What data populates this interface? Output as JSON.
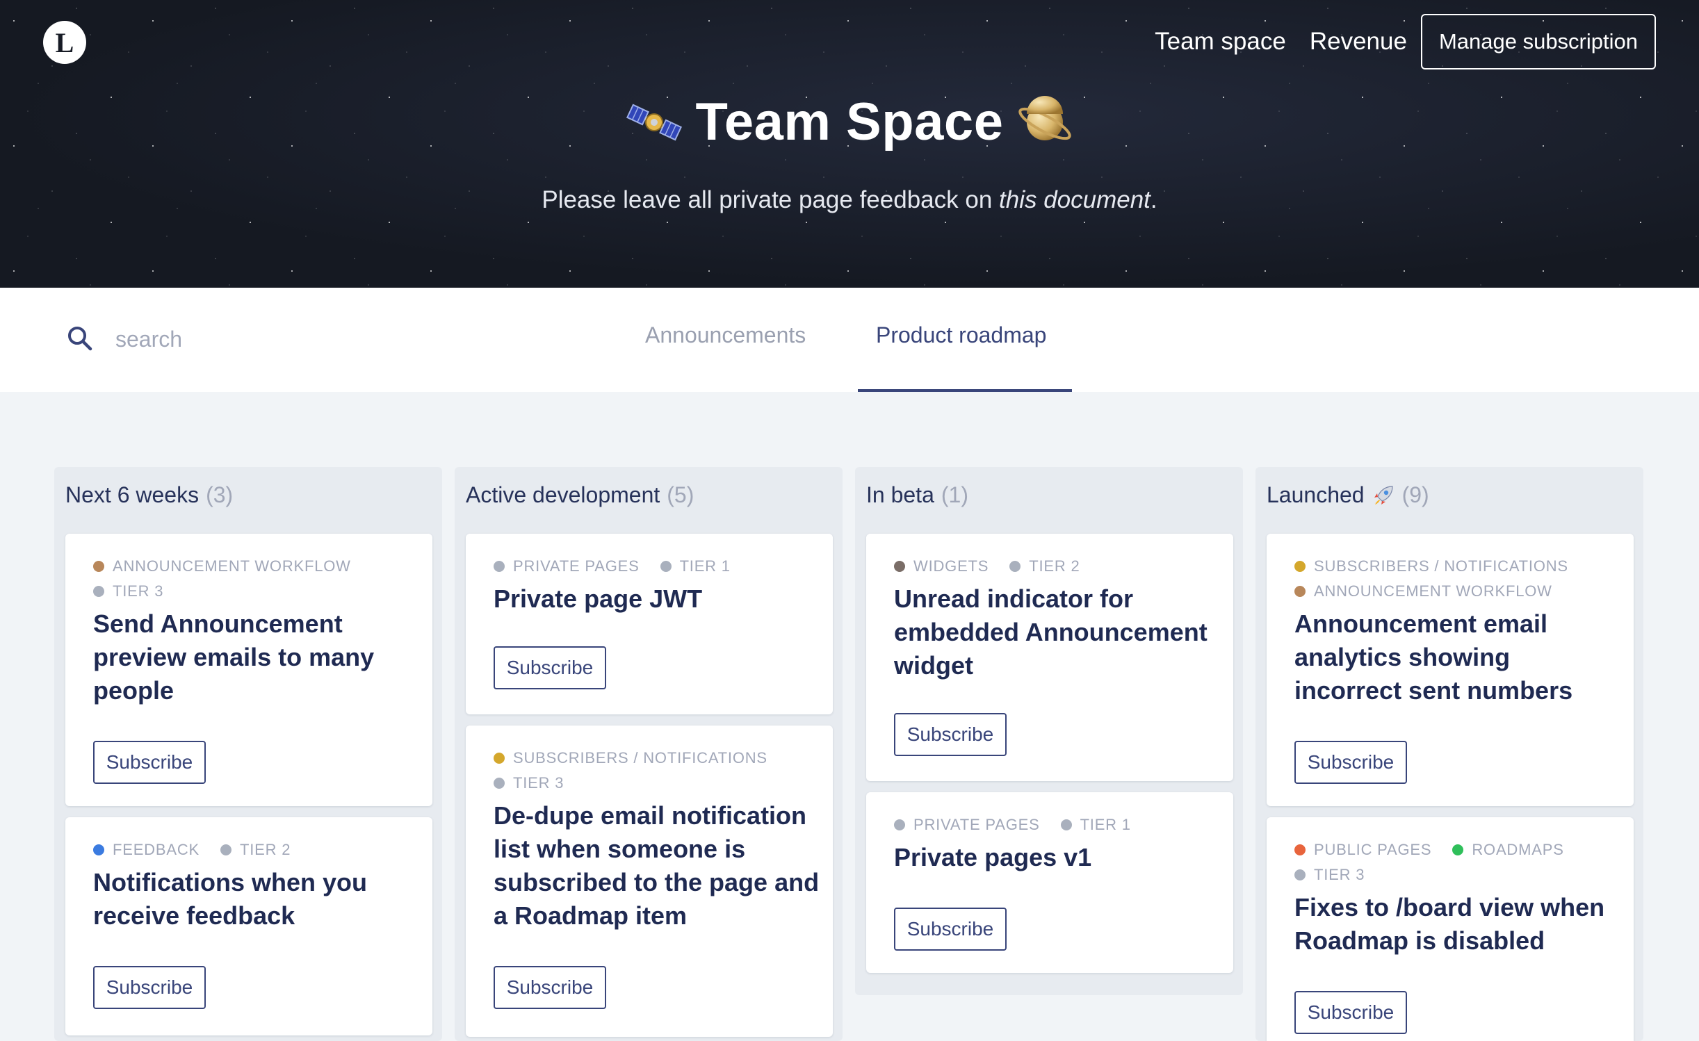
{
  "header": {
    "logo_letter": "L",
    "nav": [
      {
        "label": "Team space"
      },
      {
        "label": "Revenue"
      }
    ],
    "manage_label": "Manage subscription",
    "title": "Team Space",
    "subtitle_prefix": "Please leave all private page feedback on ",
    "subtitle_link": "this document",
    "subtitle_suffix": ".",
    "left_emoji_icon": "satellite-icon",
    "right_emoji_icon": "ringed-planet-icon"
  },
  "search": {
    "placeholder": "search",
    "value": ""
  },
  "tabs": [
    {
      "label": "Announcements",
      "active": false
    },
    {
      "label": "Product roadmap",
      "active": true
    }
  ],
  "colors": {
    "accent": "#39457a",
    "announcement_workflow": "#b8875a",
    "tier": "#a9b0bd",
    "feedback": "#3b7be0",
    "private_pages": "#a9b0bd",
    "subscribers_notifications": "#d4a72c",
    "widgets": "#7a6d67",
    "public_pages": "#e8643c",
    "roadmaps": "#2fbf5a"
  },
  "columns": [
    {
      "name": "Next 6 weeks",
      "count": "(3)",
      "cards": [
        {
          "tags": [
            {
              "label": "ANNOUNCEMENT WORKFLOW",
              "color": "#b8875a"
            },
            {
              "label": "TIER 3",
              "color": "#a9b0bd"
            }
          ],
          "title": "Send Announcement preview emails to many people",
          "button": "Subscribe"
        },
        {
          "tags": [
            {
              "label": "FEEDBACK",
              "color": "#3b7be0"
            },
            {
              "label": "TIER 2",
              "color": "#a9b0bd"
            }
          ],
          "title": "Notifications when you receive feedback",
          "button": "Subscribe"
        }
      ]
    },
    {
      "name": "Active development",
      "count": "(5)",
      "cards": [
        {
          "tags": [
            {
              "label": "PRIVATE PAGES",
              "color": "#a9b0bd"
            },
            {
              "label": "TIER 1",
              "color": "#a9b0bd"
            }
          ],
          "title": "Private page JWT",
          "button": "Subscribe"
        },
        {
          "tags": [
            {
              "label": "SUBSCRIBERS / NOTIFICATIONS",
              "color": "#d4a72c"
            },
            {
              "label": "TIER 3",
              "color": "#a9b0bd"
            }
          ],
          "title": "De-dupe email notification list when someone is subscribed to the page and a Roadmap item",
          "button": "Subscribe"
        }
      ]
    },
    {
      "name": "In beta",
      "count": "(1)",
      "cards": [
        {
          "tags": [
            {
              "label": "WIDGETS",
              "color": "#7a6d67"
            },
            {
              "label": "TIER 2",
              "color": "#a9b0bd"
            }
          ],
          "title": "Unread indicator for embedded Announcement widget",
          "button": "Subscribe"
        },
        {
          "tags": [
            {
              "label": "PRIVATE PAGES",
              "color": "#a9b0bd"
            },
            {
              "label": "TIER 1",
              "color": "#a9b0bd"
            }
          ],
          "title": "Private pages v1",
          "button": "Subscribe"
        }
      ]
    },
    {
      "name": "Launched",
      "count": "(9)",
      "emoji_icon": "rocket-icon",
      "cards": [
        {
          "tags": [
            {
              "label": "SUBSCRIBERS / NOTIFICATIONS",
              "color": "#d4a72c"
            },
            {
              "label": "ANNOUNCEMENT WORKFLOW",
              "color": "#b8875a"
            }
          ],
          "title": "Announcement email analytics showing incorrect sent numbers",
          "button": "Subscribe"
        },
        {
          "tags": [
            {
              "label": "PUBLIC PAGES",
              "color": "#e8643c"
            },
            {
              "label": "ROADMAPS",
              "color": "#2fbf5a"
            },
            {
              "label": "TIER 3",
              "color": "#a9b0bd"
            }
          ],
          "title": "Fixes to /board view when Roadmap is disabled",
          "button": "Subscribe"
        }
      ]
    }
  ]
}
